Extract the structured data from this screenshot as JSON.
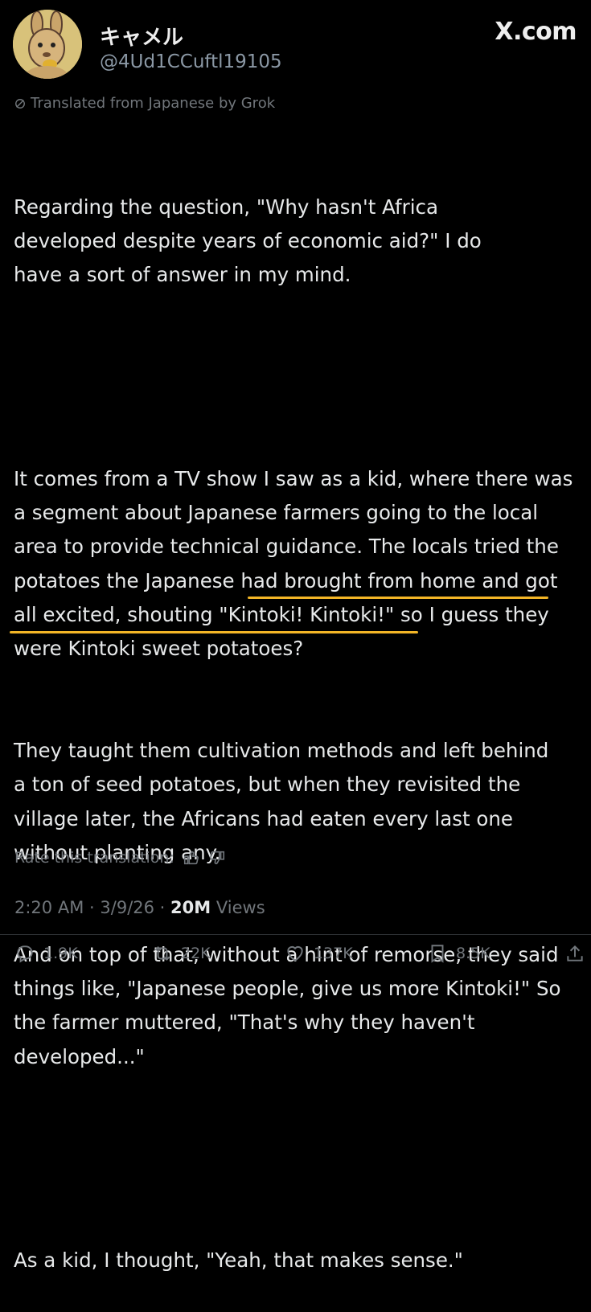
{
  "header": {
    "display_name": "キャメル",
    "handle": "@4Ud1CCuftl19105",
    "brand": "X.com"
  },
  "translation_note": "Translated from Japanese by Grok",
  "post": {
    "paragraphs": [
      "Regarding the question, \"Why hasn't Africa developed despite years of economic aid?\" I do have a sort of answer in my mind.",
      "",
      "It comes from a TV show I saw as a kid, where there was a segment about Japanese farmers going to the local area to provide technical guidance. The locals tried the potatoes the Japanese had brought from home and got all excited, shouting \"Kintoki! Kintoki!\" so I guess they were Kintoki sweet potatoes?",
      "They taught them cultivation methods and left behind a ton of seed potatoes, but when they revisited the village later, the Africans had eaten every last one without planting any.",
      "And on top of that, without a hint of remorse, they said things like, \"Japanese people, give us more Kintoki!\" So the farmer muttered, \"That's why they haven't developed...\"",
      "",
      "As a kid, I thought, \"Yeah, that makes sense.\""
    ],
    "highlight_color": "#f2b526"
  },
  "rate_translation": "Rate this translation:",
  "meta": {
    "time": "2:20 AM",
    "date": "3/9/26",
    "separator": "·",
    "views_count": "20M",
    "views_label": "Views"
  },
  "actions": {
    "replies": "1.9K",
    "reposts": "22K",
    "likes": "137K",
    "bookmarks": "8.5K"
  },
  "colors": {
    "background": "#000000",
    "text": "#e7e9ea",
    "muted": "#71767b",
    "handle": "#8b98a5"
  }
}
